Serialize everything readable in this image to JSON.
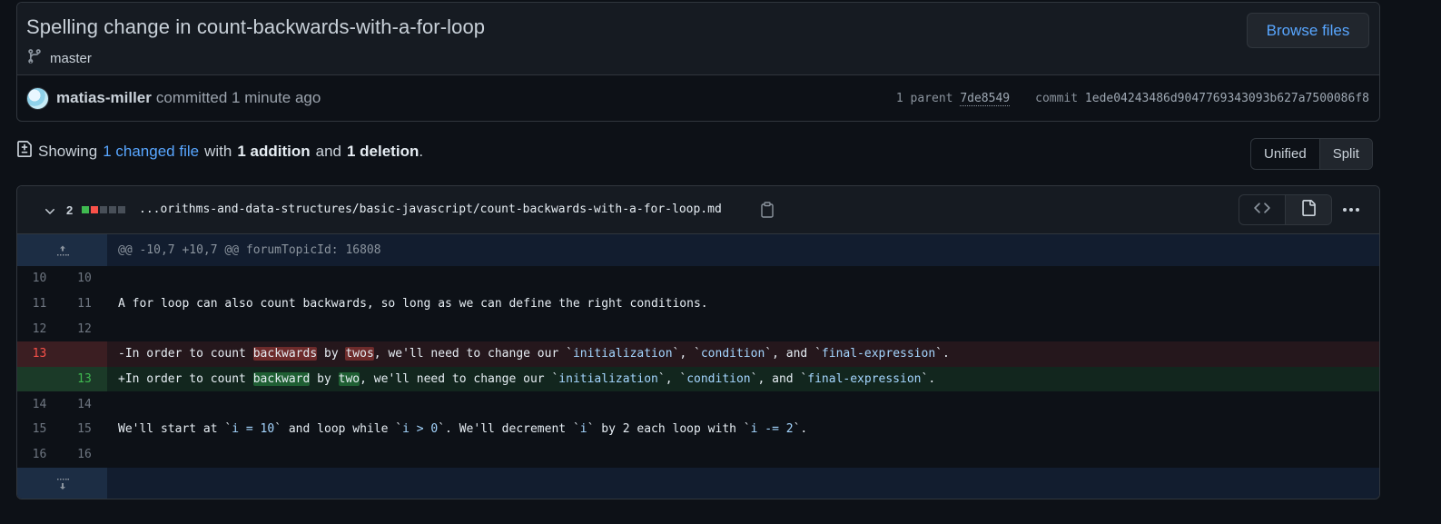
{
  "commit": {
    "title": "Spelling change in count-backwards-with-a-for-loop",
    "branch": "master",
    "browse_label": "Browse files",
    "author": "matias-miller",
    "committed_text": "committed 1 minute ago",
    "parent_label": "1 parent",
    "parent_sha": "7de8549",
    "commit_label": "commit",
    "commit_sha": "1ede04243486d9047769343093b627a7500086f8"
  },
  "summary": {
    "showing": "Showing",
    "changed": "1 changed file",
    "with": "with",
    "additions": "1 addition",
    "and": "and",
    "deletions": "1 deletion",
    "period": "."
  },
  "view_toggle": {
    "unified": "Unified",
    "split": "Split"
  },
  "file": {
    "count": "2",
    "name": "...orithms-and-data-structures/basic-javascript/count-backwards-with-a-for-loop.md",
    "hunk_header": "@@ -10,7 +10,7 @@ forumTopicId: 16808",
    "colors": {
      "add": "#3fb950",
      "del": "#f85149",
      "neutral": "#484f58"
    }
  },
  "diff_lines": [
    {
      "old": "10",
      "new": "10",
      "text": ""
    },
    {
      "old": "11",
      "new": "11",
      "text": "A for loop can also count backwards, so long as we can define the right conditions."
    },
    {
      "old": "12",
      "new": "12",
      "text": ""
    },
    {
      "old": "13",
      "new": "",
      "sign": "-",
      "pre": "In order to count ",
      "w1": "backwards",
      "mid": " by ",
      "w2": "twos",
      "post": ", we'll need to change our `",
      "c1": "initialization",
      "s1": "`, `",
      "c2": "condition",
      "s2": "`, and `",
      "c3": "final-expression",
      "s3": "`."
    },
    {
      "old": "",
      "new": "13",
      "sign": "+",
      "pre": "In order to count ",
      "w1": "backward",
      "mid": " by ",
      "w2": "two",
      "post": ", we'll need to change our `",
      "c1": "initialization",
      "s1": "`, `",
      "c2": "condition",
      "s2": "`, and `",
      "c3": "final-expression",
      "s3": "`."
    },
    {
      "old": "14",
      "new": "14",
      "text": ""
    },
    {
      "old": "15",
      "new": "15",
      "pre": "We'll start at `",
      "c1": "i = 10",
      "s1": "` and loop while `",
      "c2": "i > 0",
      "s2": "`. We'll decrement `",
      "c3": "i",
      "s3": "` by 2 each loop with `",
      "c4": "i -= 2",
      "s4": "`."
    },
    {
      "old": "16",
      "new": "16",
      "text": ""
    }
  ]
}
